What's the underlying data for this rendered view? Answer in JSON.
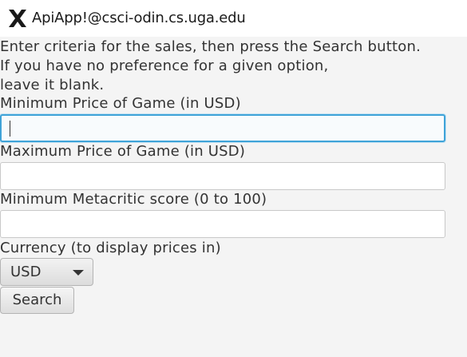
{
  "window": {
    "title": "ApiApp!@csci-odin.cs.uga.edu",
    "icon": "x11-logo-icon"
  },
  "instructions": [
    "Enter criteria for the sales, then press the Search button.",
    "If you have no preference for a given option,",
    "leave it blank."
  ],
  "fields": {
    "min_price": {
      "label": "Minimum Price of Game (in USD)",
      "value": "",
      "placeholder": ""
    },
    "max_price": {
      "label": "Maximum Price of Game (in USD)",
      "value": "",
      "placeholder": ""
    },
    "min_metacritic": {
      "label": "Minimum Metacritic score (0 to 100)",
      "value": "",
      "placeholder": ""
    }
  },
  "currency": {
    "label": "Currency (to display prices in)",
    "selected": "USD"
  },
  "search_button": {
    "label": "Search"
  },
  "colors": {
    "background": "#f4f4f4",
    "focus_border": "#3fa3d8",
    "text": "#333333"
  }
}
